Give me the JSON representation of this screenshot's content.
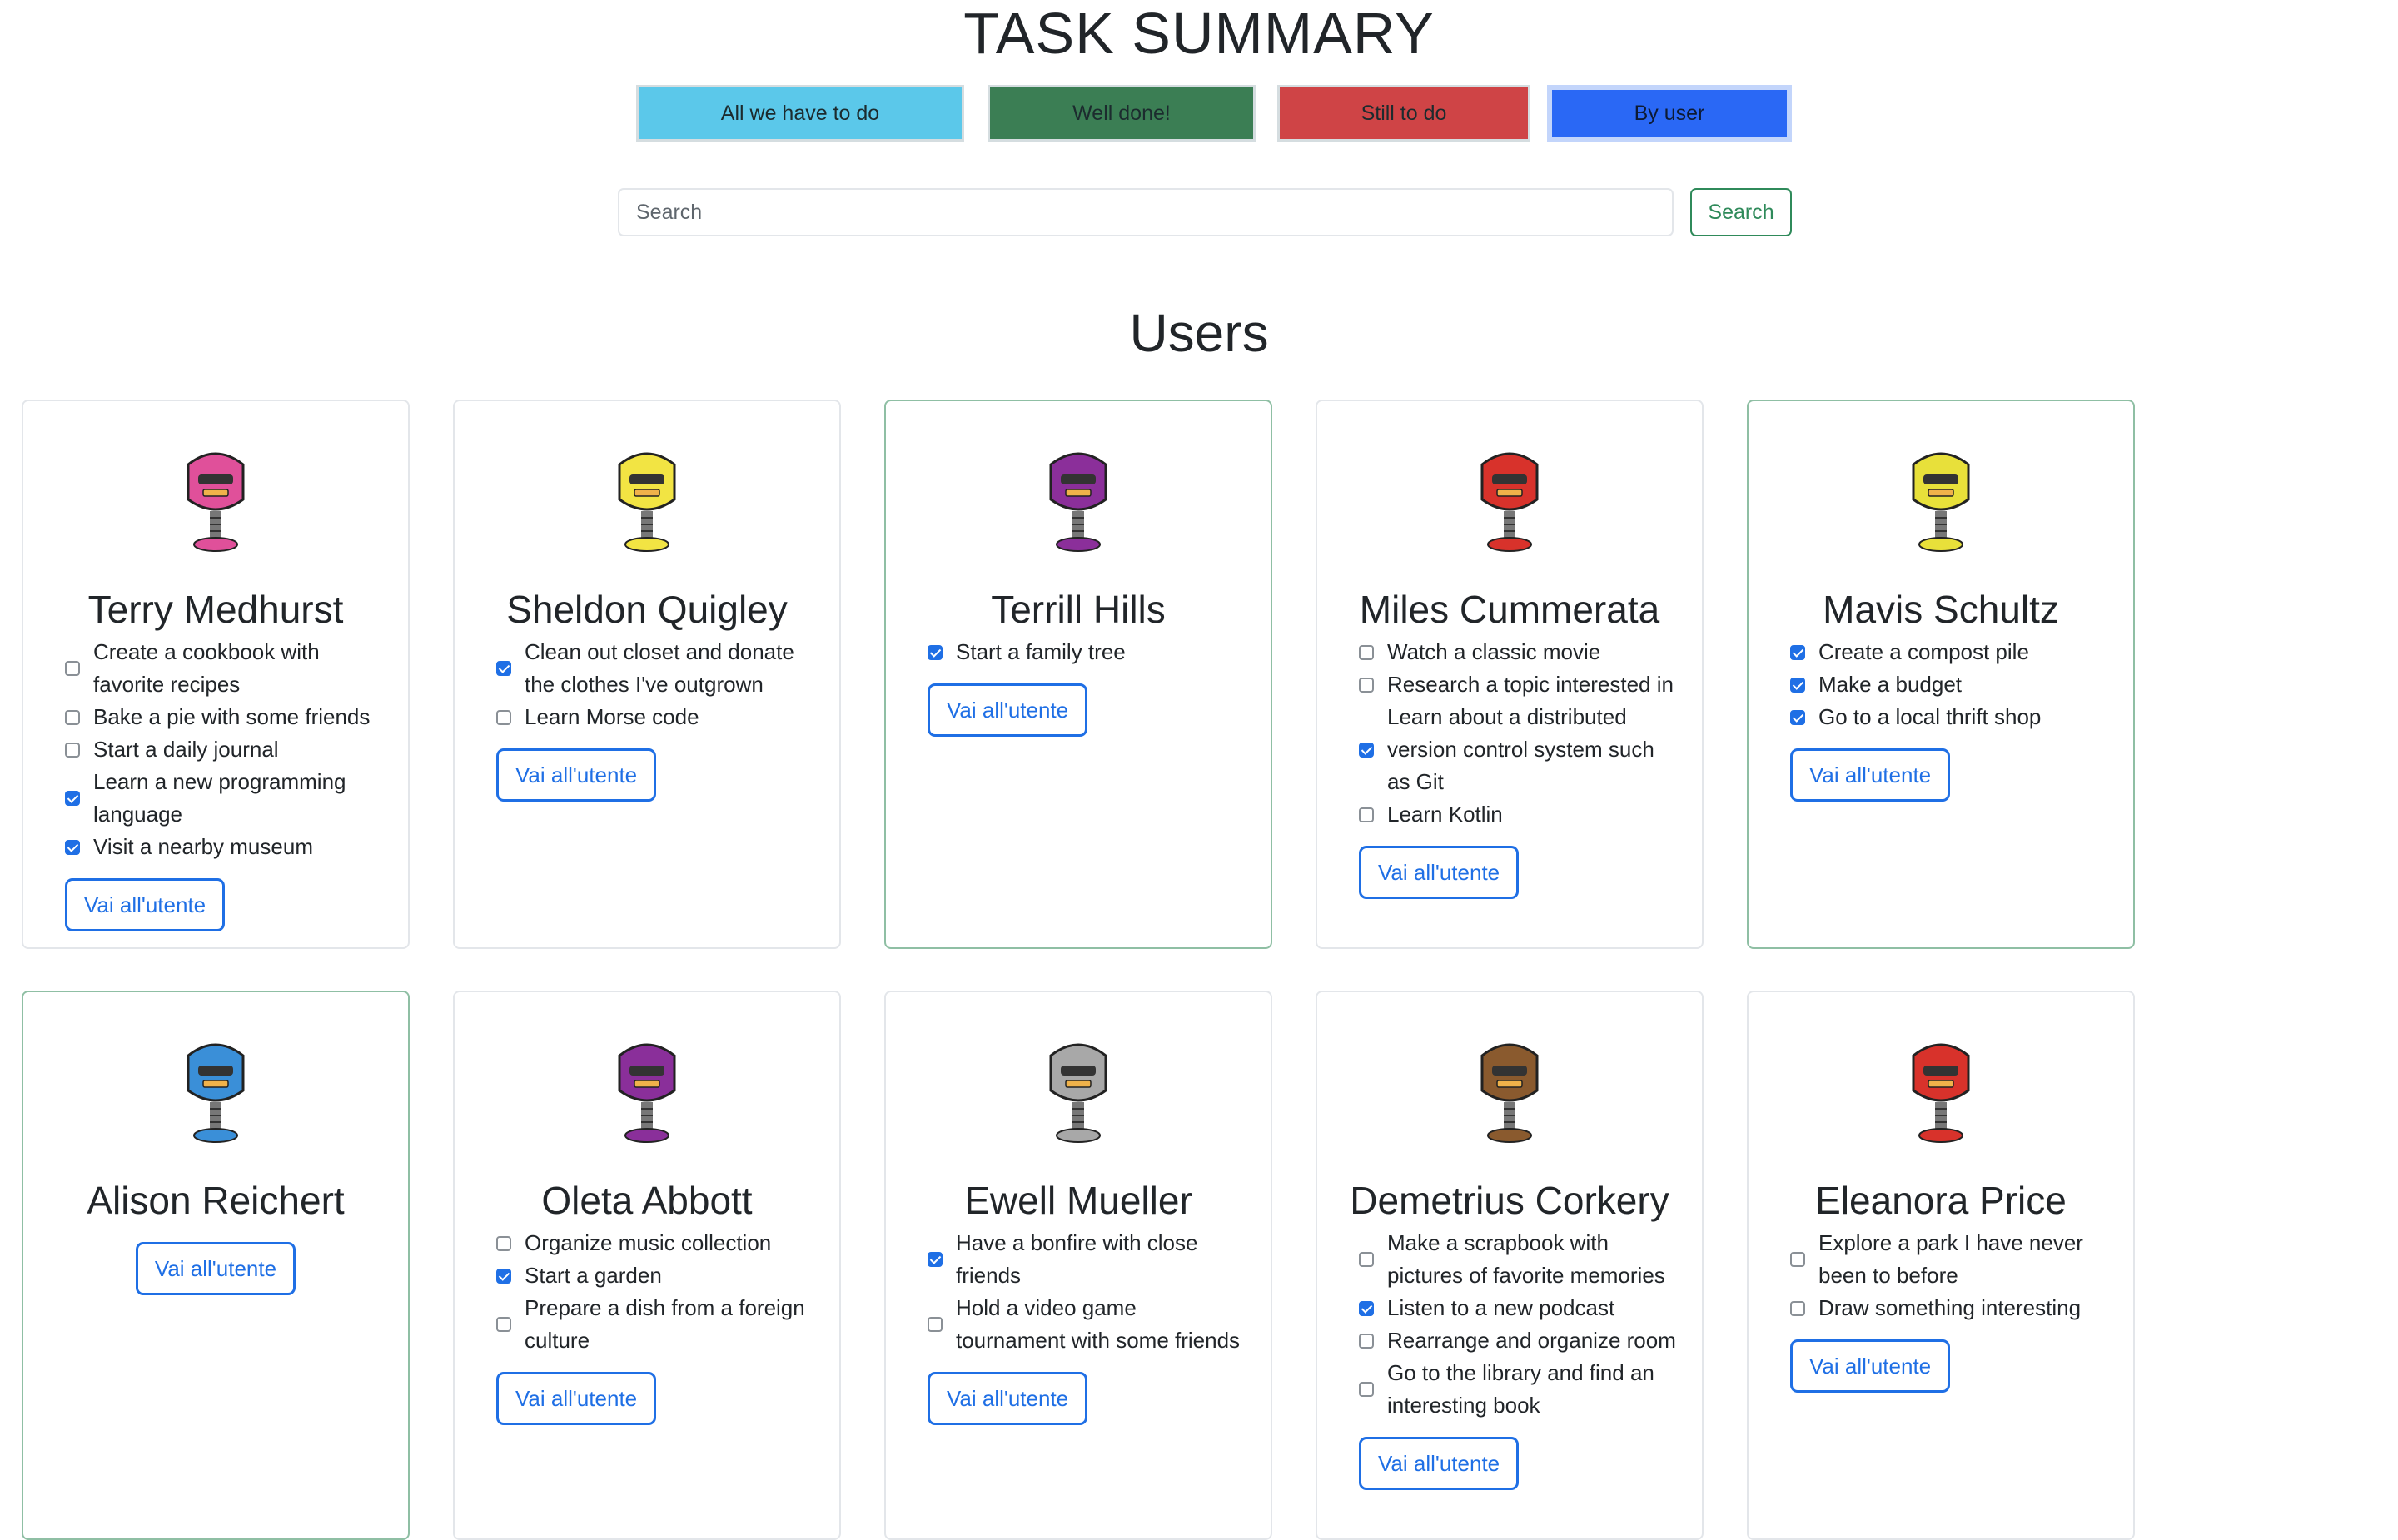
{
  "header": {
    "title": "TASK SUMMARY"
  },
  "filters": [
    {
      "label": "All we have to do",
      "color": "#5bc8ea"
    },
    {
      "label": "Well done!",
      "color": "#3b7e54"
    },
    {
      "label": "Still to do",
      "color": "#cf4446"
    },
    {
      "label": "By user",
      "color": "#2a68f5"
    }
  ],
  "search": {
    "placeholder": "Search",
    "button_label": "Search"
  },
  "section_title": "Users",
  "cta_label": "Vai all'utente",
  "users": [
    {
      "name": "Terry Medhurst",
      "avatar_color": "#e0509a",
      "tasks": [
        {
          "text": "Create a cookbook with favorite recipes",
          "done": false
        },
        {
          "text": "Bake a pie with some friends",
          "done": false
        },
        {
          "text": "Start a daily journal",
          "done": false
        },
        {
          "text": "Learn a new programming language",
          "done": true
        },
        {
          "text": "Visit a nearby museum",
          "done": true
        }
      ]
    },
    {
      "name": "Sheldon Quigley",
      "avatar_color": "#f2e443",
      "tasks": [
        {
          "text": "Clean out closet and donate the clothes I've outgrown",
          "done": true
        },
        {
          "text": "Learn Morse code",
          "done": false
        }
      ]
    },
    {
      "name": "Terrill Hills",
      "avatar_color": "#8b2f9a",
      "tasks": [
        {
          "text": "Start a family tree",
          "done": true
        }
      ]
    },
    {
      "name": "Miles Cummerata",
      "avatar_color": "#d8322b",
      "tasks": [
        {
          "text": "Watch a classic movie",
          "done": false
        },
        {
          "text": "Research a topic interested in",
          "done": false
        },
        {
          "text": "Learn about a distributed version control system such as Git",
          "done": true
        },
        {
          "text": "Learn Kotlin",
          "done": false
        }
      ]
    },
    {
      "name": "Mavis Schultz",
      "avatar_color": "#e8e03a",
      "tasks": [
        {
          "text": "Create a compost pile",
          "done": true
        },
        {
          "text": "Make a budget",
          "done": true
        },
        {
          "text": "Go to a local thrift shop",
          "done": true
        }
      ]
    },
    {
      "name": "Alison Reichert",
      "avatar_color": "#3a8fd8",
      "tasks": []
    },
    {
      "name": "Oleta Abbott",
      "avatar_color": "#8a2f9a",
      "tasks": [
        {
          "text": "Organize music collection",
          "done": false
        },
        {
          "text": "Start a garden",
          "done": true
        },
        {
          "text": "Prepare a dish from a foreign culture",
          "done": false
        }
      ]
    },
    {
      "name": "Ewell Mueller",
      "avatar_color": "#a8a8a8",
      "tasks": [
        {
          "text": "Have a bonfire with close friends",
          "done": true
        },
        {
          "text": "Hold a video game tournament with some friends",
          "done": false
        }
      ]
    },
    {
      "name": "Demetrius Corkery",
      "avatar_color": "#8a5a2e",
      "tasks": [
        {
          "text": "Make a scrapbook with pictures of favorite memories",
          "done": false
        },
        {
          "text": "Listen to a new podcast",
          "done": true
        },
        {
          "text": "Rearrange and organize room",
          "done": false
        },
        {
          "text": "Go to the library and find an interesting book",
          "done": false
        }
      ]
    },
    {
      "name": "Eleanora Price",
      "avatar_color": "#d8322b",
      "tasks": [
        {
          "text": "Explore a park I have never been to before",
          "done": false
        },
        {
          "text": "Draw something interesting",
          "done": false
        }
      ]
    }
  ]
}
